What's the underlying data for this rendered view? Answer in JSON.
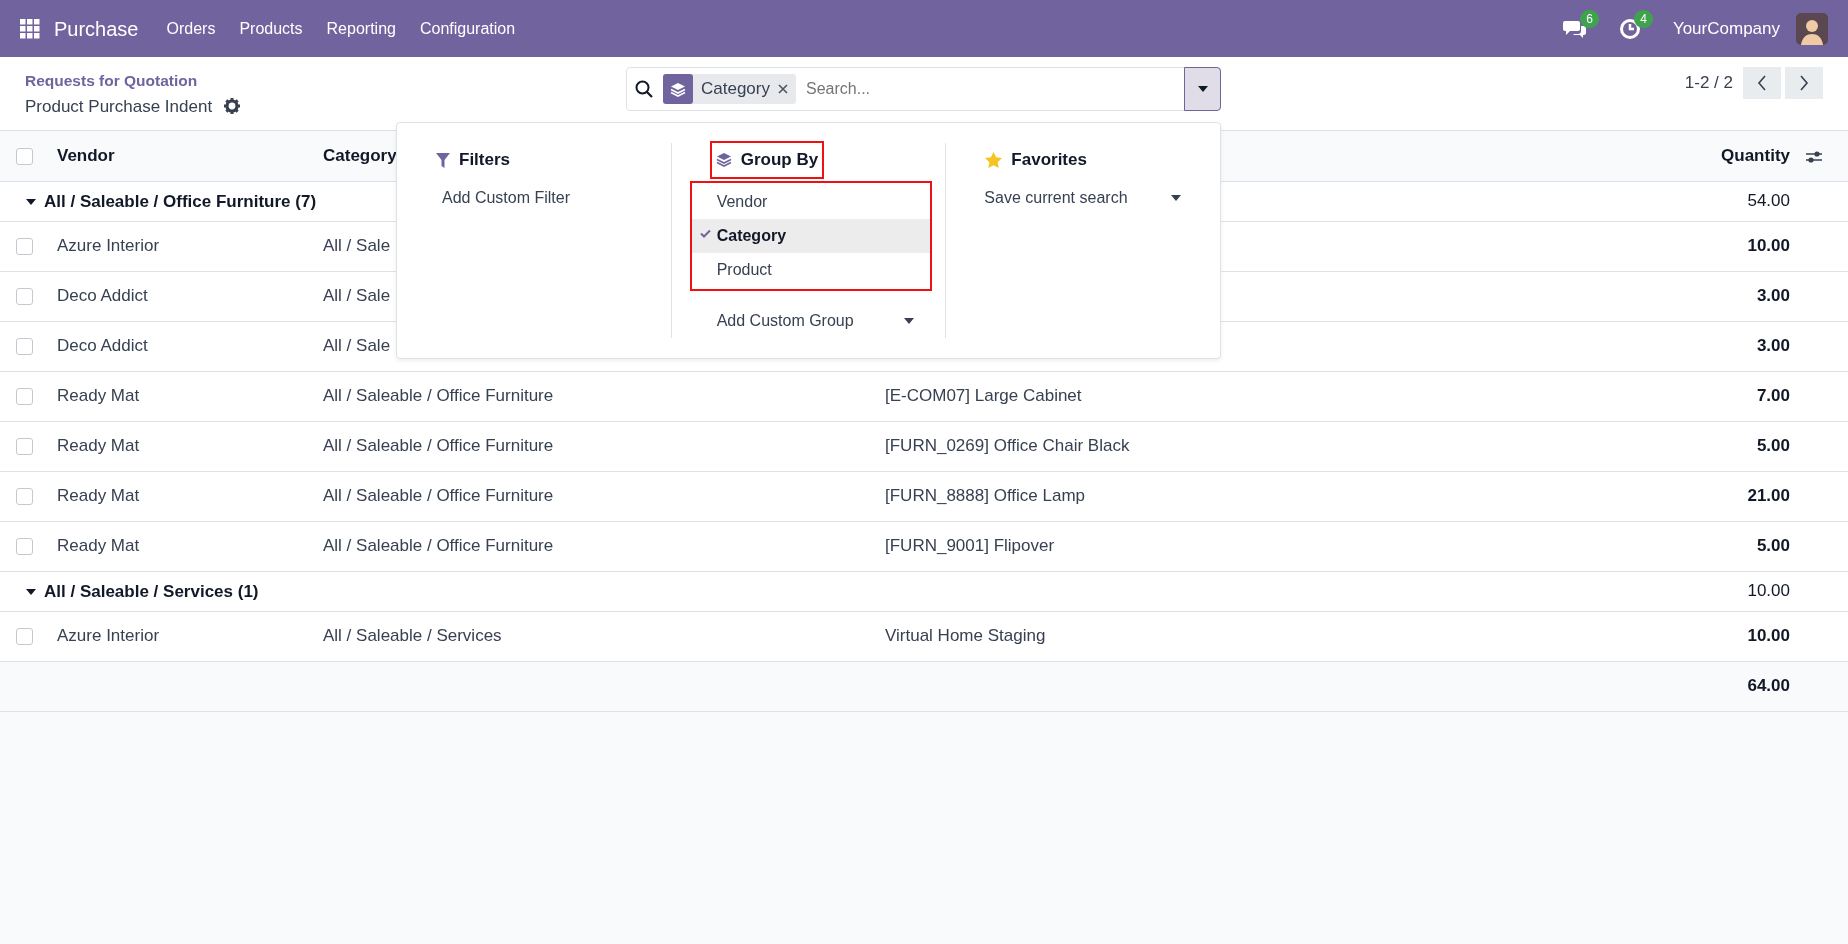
{
  "navbar": {
    "app": "Purchase",
    "menu": [
      "Orders",
      "Products",
      "Reporting",
      "Configuration"
    ],
    "messages_count": "6",
    "activities_count": "4",
    "company": "YourCompany"
  },
  "breadcrumb": {
    "parent": "Requests for Quotation",
    "current": "Product Purchase Indent"
  },
  "search": {
    "facet": "Category",
    "placeholder": "Search..."
  },
  "pager": "1-2 / 2",
  "dropdown": {
    "filters": {
      "title": "Filters",
      "items": [
        "Add Custom Filter"
      ]
    },
    "group_by": {
      "title": "Group By",
      "title_annotated": true,
      "options_annotated": true,
      "options": [
        {
          "label": "Vendor",
          "selected": false
        },
        {
          "label": "Category",
          "selected": true
        },
        {
          "label": "Product",
          "selected": false
        }
      ],
      "custom": "Add Custom Group"
    },
    "favorites": {
      "title": "Favorites",
      "items": [
        "Save current search"
      ]
    }
  },
  "table": {
    "columns": [
      "Vendor",
      "Category",
      "Quantity"
    ],
    "all_checked": false,
    "groups": [
      {
        "label": "All / Saleable / Office Furniture (7)",
        "expanded": true,
        "total": "54.00",
        "rows": [
          {
            "vendor": "Azure Interior",
            "checked": false,
            "category": "All / Sale",
            "quantity": "10.00"
          },
          {
            "vendor": "Deco Addict",
            "checked": false,
            "category": "All / Sale",
            "quantity": "3.00"
          },
          {
            "vendor": "Deco Addict",
            "checked": false,
            "category": "All / Sale",
            "quantity": "3.00"
          },
          {
            "vendor": "Ready Mat",
            "checked": false,
            "category": "All / Saleable / Office Furniture",
            "product": "[E-COM07] Large Cabinet",
            "quantity": "7.00"
          },
          {
            "vendor": "Ready Mat",
            "checked": false,
            "category": "All / Saleable / Office Furniture",
            "product": "[FURN_0269] Office Chair Black",
            "quantity": "5.00"
          },
          {
            "vendor": "Ready Mat",
            "checked": false,
            "category": "All / Saleable / Office Furniture",
            "product": "[FURN_8888] Office Lamp",
            "quantity": "21.00"
          },
          {
            "vendor": "Ready Mat",
            "checked": false,
            "category": "All / Saleable / Office Furniture",
            "product": "[FURN_9001] Flipover",
            "quantity": "5.00"
          }
        ]
      },
      {
        "label": "All / Saleable / Services (1)",
        "expanded": true,
        "total": "10.00",
        "rows": [
          {
            "vendor": "Azure Interior",
            "checked": false,
            "category": "All / Saleable / Services",
            "product": "Virtual Home Staging",
            "quantity": "10.00"
          }
        ]
      }
    ],
    "grand_total": "64.00"
  }
}
